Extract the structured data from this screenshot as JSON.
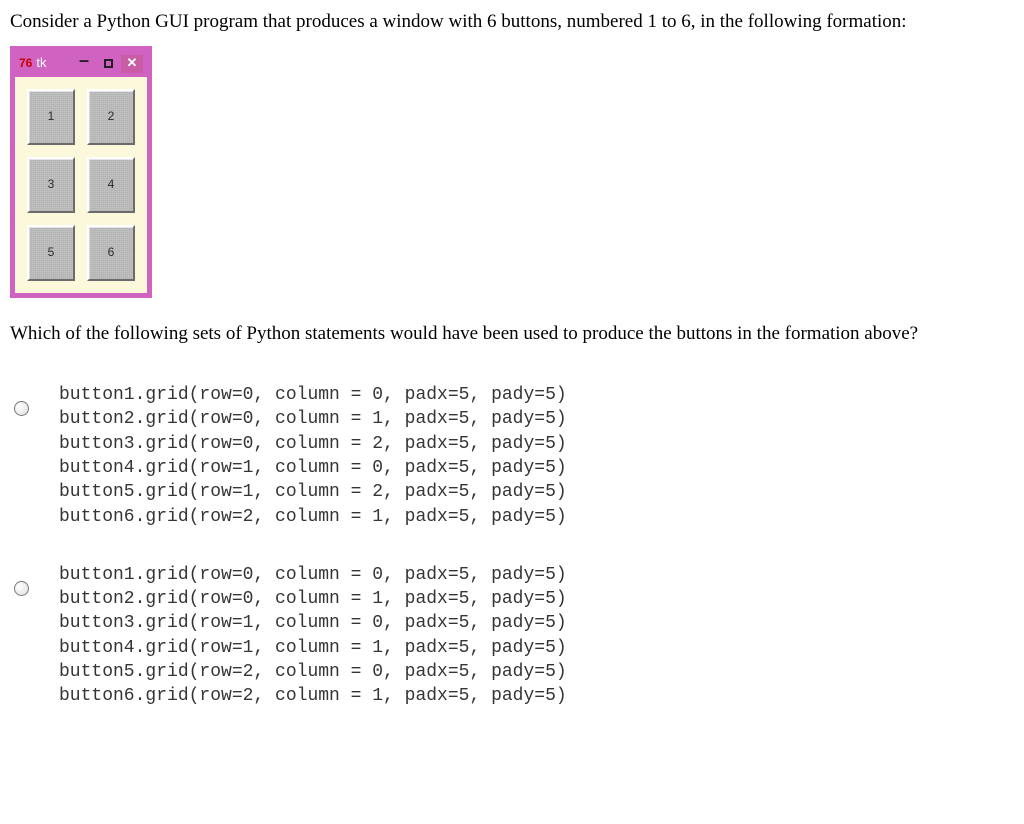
{
  "intro": "Consider a Python GUI program that produces a window with 6 buttons, numbered 1 to 6, in the following formation:",
  "tk": {
    "icon": "76",
    "title": "tk",
    "buttons": {
      "b1": "1",
      "b2": "2",
      "b3": "3",
      "b4": "4",
      "b5": "5",
      "b6": "6"
    }
  },
  "question": "Which of the following sets of Python statements would have been used to produce the buttons in the formation above?",
  "options": {
    "a": {
      "l1": "button1.grid(row=0, column = 0, padx=5, pady=5)",
      "l2": "button2.grid(row=0, column = 1, padx=5, pady=5)",
      "l3": "button3.grid(row=0, column = 2, padx=5, pady=5)",
      "l4": "button4.grid(row=1, column = 0, padx=5, pady=5)",
      "l5": "button5.grid(row=1, column = 2, padx=5, pady=5)",
      "l6": "button6.grid(row=2, column = 1, padx=5, pady=5)"
    },
    "b": {
      "l1": "button1.grid(row=0, column = 0, padx=5, pady=5)",
      "l2": "button2.grid(row=0, column = 1, padx=5, pady=5)",
      "l3": "button3.grid(row=1, column = 0, padx=5, pady=5)",
      "l4": "button4.grid(row=1, column = 1, padx=5, pady=5)",
      "l5": "button5.grid(row=2, column = 0, padx=5, pady=5)",
      "l6": "button6.grid(row=2, column = 1, padx=5, pady=5)"
    }
  }
}
